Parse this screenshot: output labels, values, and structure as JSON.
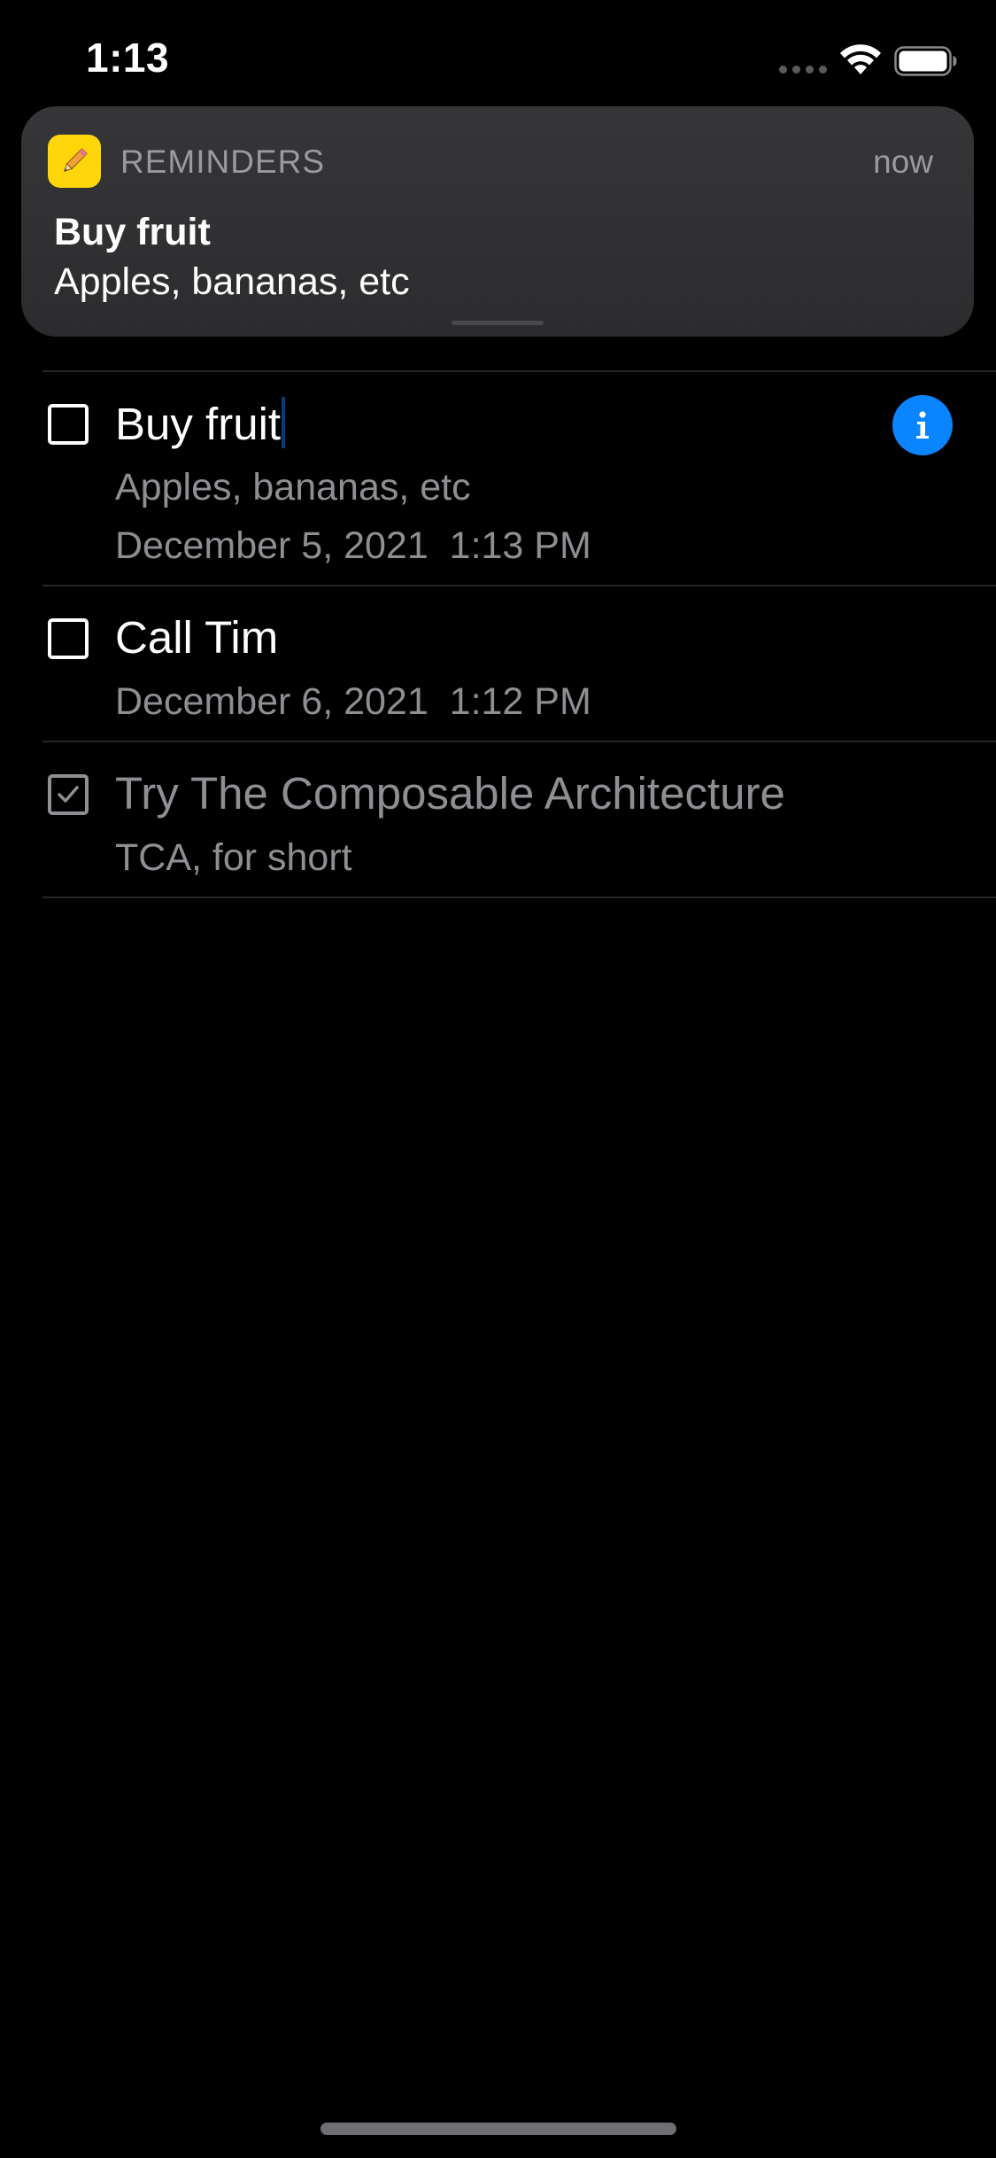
{
  "status_bar": {
    "time": "1:13",
    "signal_icon": "cellular-dots-icon",
    "wifi_icon": "wifi-icon",
    "battery_icon": "battery-full-icon"
  },
  "notification": {
    "app_icon": "pencil-icon",
    "app_name": "REMINDERS",
    "time": "now",
    "title": "Buy fruit",
    "body": "Apples, bananas, etc"
  },
  "reminders": [
    {
      "title": "Buy fruit",
      "notes": "Apples, bananas, etc",
      "due": "December 5, 2021  1:13 PM",
      "completed": false,
      "editing": true,
      "info_icon": "info-icon"
    },
    {
      "title": "Call Tim",
      "due": "December 6, 2021  1:12 PM",
      "completed": false
    },
    {
      "title": "Try The Composable Architecture",
      "notes": "TCA, for short",
      "completed": true
    }
  ],
  "colors": {
    "background": "#000000",
    "accent": "#0a84ff",
    "app_icon": "#ffd60a",
    "secondary_text": "#8e8e93",
    "banner": "#2c2c2e"
  }
}
